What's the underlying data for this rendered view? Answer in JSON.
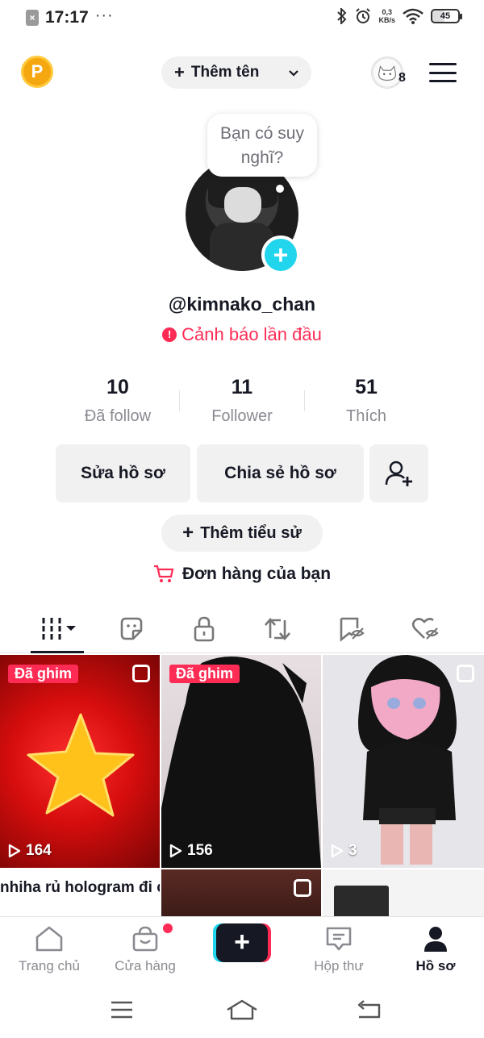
{
  "status_bar": {
    "time": "17:17",
    "dots": "···",
    "net_speed_value": "0,3",
    "net_speed_unit": "KB/s",
    "battery": "45"
  },
  "header": {
    "coin_letter": "P",
    "add_name_label": "Thêm tên",
    "friends_count": "8"
  },
  "profile": {
    "thought_bubble": "Bạn có suy nghĩ?",
    "username": "@kimnako_chan",
    "warning": "Cảnh báo lần đầu"
  },
  "stats": [
    {
      "value": "10",
      "label": "Đã follow"
    },
    {
      "value": "11",
      "label": "Follower"
    },
    {
      "value": "51",
      "label": "Thích"
    }
  ],
  "actions": {
    "edit_profile": "Sửa hồ sơ",
    "share_profile": "Chia sẻ hồ sơ",
    "add_bio": "Thêm tiểu sử",
    "orders": "Đơn hàng của bạn"
  },
  "tabs": [
    "videos-grid-icon",
    "sticker-icon",
    "lock-icon",
    "repost-icon",
    "favorites-icon",
    "liked-icon"
  ],
  "videos": [
    {
      "pinned_label": "Đã ghim",
      "views": "164"
    },
    {
      "pinned_label": "Đã ghim",
      "views": "156"
    },
    {
      "pinned_label": "",
      "views": "3"
    }
  ],
  "caption_row": {
    "caption": "nhiha rủ hologram đi c"
  },
  "bottom_nav": [
    {
      "label": "Trang chủ"
    },
    {
      "label": "Cửa hàng"
    },
    {
      "label": "Hộp thư"
    },
    {
      "label": "Hồ sơ"
    }
  ],
  "colors": {
    "accent_red": "#fe2c55",
    "accent_cyan": "#20d5ec",
    "text_primary": "#161823",
    "text_secondary": "#8a8b91"
  }
}
